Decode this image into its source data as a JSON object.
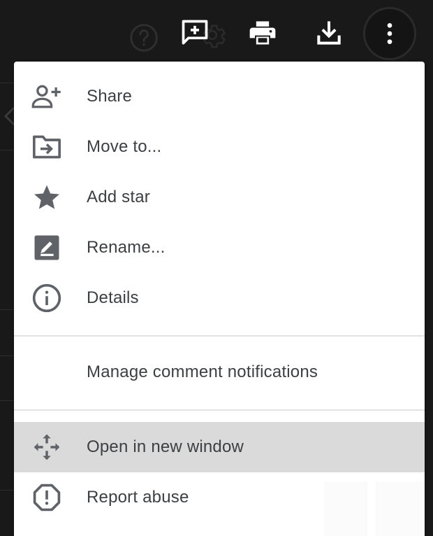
{
  "toolbar": {
    "icons": [
      "help-icon",
      "add-comment-icon",
      "settings-icon",
      "print-icon",
      "download-icon",
      "more-vert-icon"
    ]
  },
  "menu": {
    "items": [
      {
        "label": "Share",
        "icon": "person-add-icon"
      },
      {
        "label": "Move to...",
        "icon": "folder-move-icon"
      },
      {
        "label": "Add star",
        "icon": "star-icon"
      },
      {
        "label": "Rename...",
        "icon": "rename-icon"
      },
      {
        "label": "Details",
        "icon": "info-icon"
      },
      {
        "label": "Manage comment notifications",
        "icon": ""
      },
      {
        "label": "Open in new window",
        "icon": "open-with-icon",
        "highlighted": true
      },
      {
        "label": "Report abuse",
        "icon": "report-icon"
      }
    ]
  },
  "colors": {
    "background": "#191919",
    "menu_bg": "#ffffff",
    "highlight": "#dadada",
    "text": "#3c4043",
    "icon": "#5f6368",
    "toolbar_icon": "#ffffff"
  }
}
